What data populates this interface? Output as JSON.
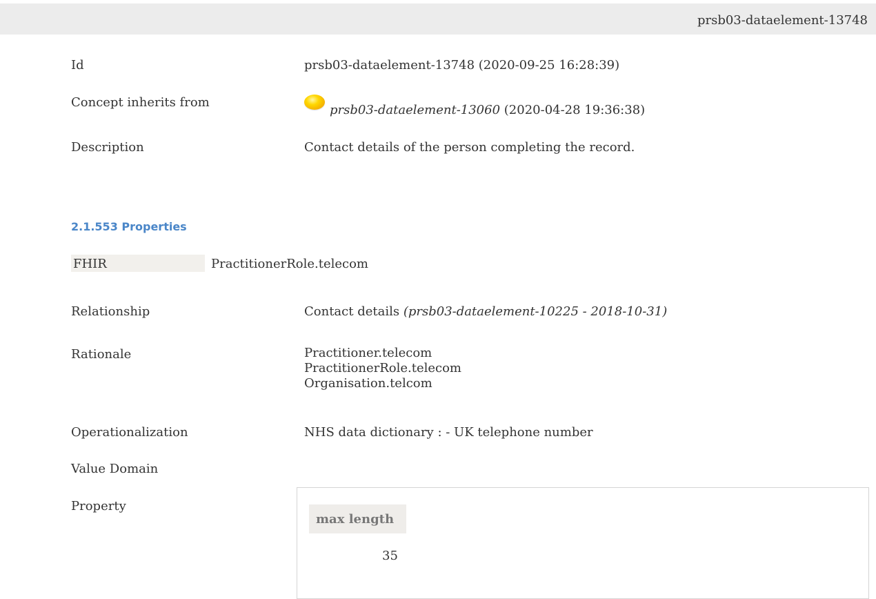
{
  "header": {
    "id": "prsb03-dataelement-13748"
  },
  "fields": {
    "id": {
      "label": "Id",
      "value": "prsb03-dataelement-13748 (2020-09-25 16:28:39)"
    },
    "inherits": {
      "label": "Concept inherits from",
      "ref": "prsb03-dataelement-13060",
      "date": "(2020-04-28 19:36:38)",
      "status_icon": "yellow-status-ball-icon"
    },
    "description": {
      "label": "Description",
      "value": "Contact details of the person completing the record."
    }
  },
  "properties": {
    "section_title": "2.1.553 Properties",
    "fhir": {
      "label": "FHIR",
      "value": "PractitionerRole.telecom"
    },
    "relationship": {
      "label": "Relationship",
      "value": "Contact details",
      "ref": "(prsb03-dataelement-10225 - 2018-10-31)"
    },
    "rationale": {
      "label": "Rationale",
      "lines": [
        "Practitioner.telecom",
        "PractitionerRole.telecom",
        "Organisation.telcom"
      ]
    },
    "operationalization": {
      "label": "Operationalization",
      "value": "NHS data dictionary : - UK telephone number"
    },
    "value_domain": {
      "label": "Value Domain"
    },
    "property": {
      "label": "Property",
      "table_header": "max length",
      "table_value": "35"
    }
  }
}
